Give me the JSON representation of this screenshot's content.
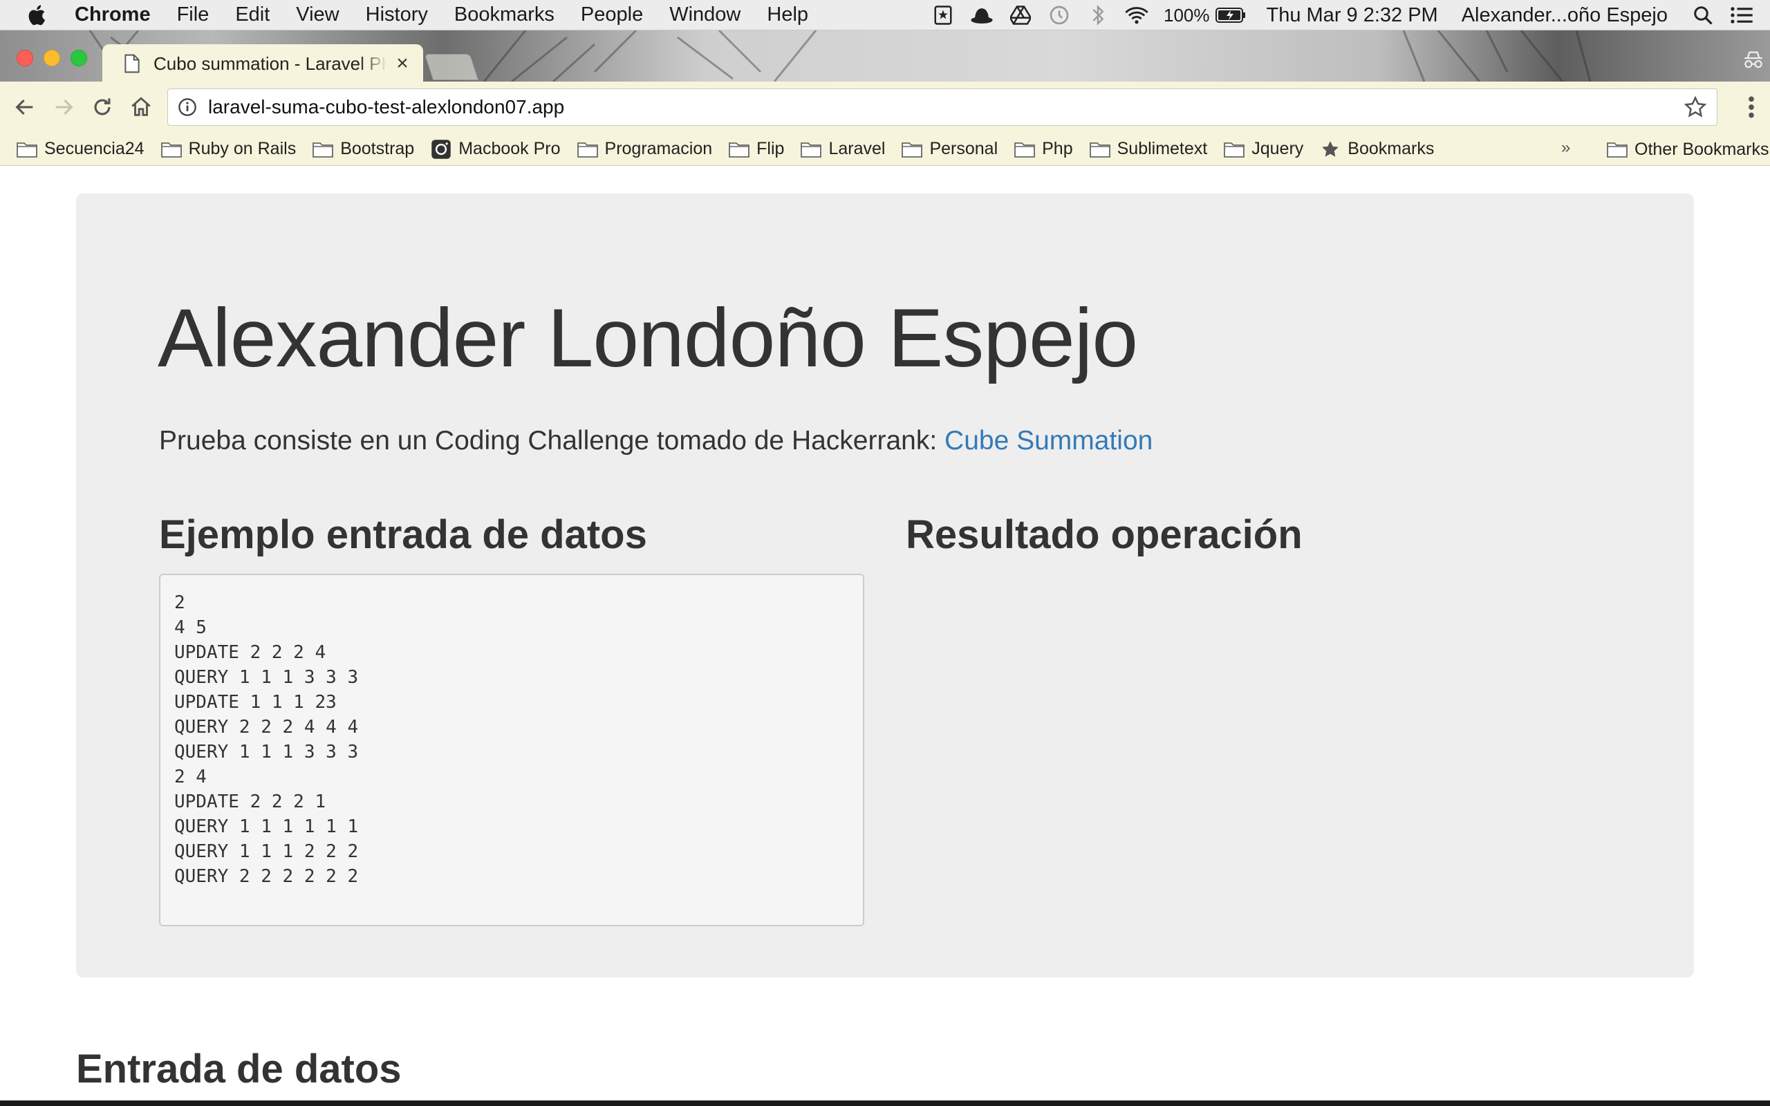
{
  "menubar": {
    "app_name": "Chrome",
    "items": [
      "File",
      "Edit",
      "View",
      "History",
      "Bookmarks",
      "People",
      "Window",
      "Help"
    ],
    "battery": "100%",
    "datetime": "Thu Mar 9  2:32 PM",
    "user": "Alexander...oño Espejo",
    "status_icons": [
      "script-editor-icon",
      "bowler-hat-icon",
      "drive-icon",
      "time-machine-icon",
      "bluetooth-icon",
      "wifi-icon",
      "battery-icon",
      "spotlight-icon",
      "notification-center-icon"
    ]
  },
  "browser": {
    "tab_title": "Cubo summation - Laravel PHP",
    "tab_close": "×",
    "url": "laravel-suma-cubo-test-alexlondon07.app"
  },
  "bookmarks": {
    "items": [
      {
        "label": "Secuencia24",
        "icon": "folder-icon"
      },
      {
        "label": "Ruby on Rails",
        "icon": "folder-icon"
      },
      {
        "label": "Bootstrap",
        "icon": "folder-icon"
      },
      {
        "label": "Macbook Pro",
        "icon": "camera-icon"
      },
      {
        "label": "Programacion",
        "icon": "folder-icon"
      },
      {
        "label": "Flip",
        "icon": "folder-icon"
      },
      {
        "label": "Laravel",
        "icon": "folder-icon"
      },
      {
        "label": "Personal",
        "icon": "folder-icon"
      },
      {
        "label": "Php",
        "icon": "folder-icon"
      },
      {
        "label": "Sublimetext",
        "icon": "folder-icon"
      },
      {
        "label": "Jquery",
        "icon": "folder-icon"
      },
      {
        "label": "Bookmarks",
        "icon": "star-icon"
      }
    ],
    "more": "»",
    "other": "Other Bookmarks"
  },
  "page": {
    "title": "Alexander Londoño Espejo",
    "lead_text": "Prueba consiste en un Coding Challenge tomado de Hackerrank: ",
    "lead_link": "Cube Summation",
    "example_heading": "Ejemplo entrada de datos",
    "result_heading": "Resultado operación",
    "example_lines": [
      "2",
      "4 5",
      "UPDATE 2 2 2 4",
      "QUERY 1 1 1 3 3 3",
      "UPDATE 1 1 1 23",
      "QUERY 2 2 2 4 4 4",
      "QUERY 1 1 1 3 3 3",
      "2 4",
      "UPDATE 2 2 2 1",
      "QUERY 1 1 1 1 1 1",
      "QUERY 1 1 1 2 2 2",
      "QUERY 2 2 2 2 2 2"
    ],
    "input_heading": "Entrada de datos"
  },
  "colors": {
    "link": "#337ab7",
    "jumbotron_bg": "#eeeeee",
    "chrome_toolbar": "#f6f4dc"
  }
}
